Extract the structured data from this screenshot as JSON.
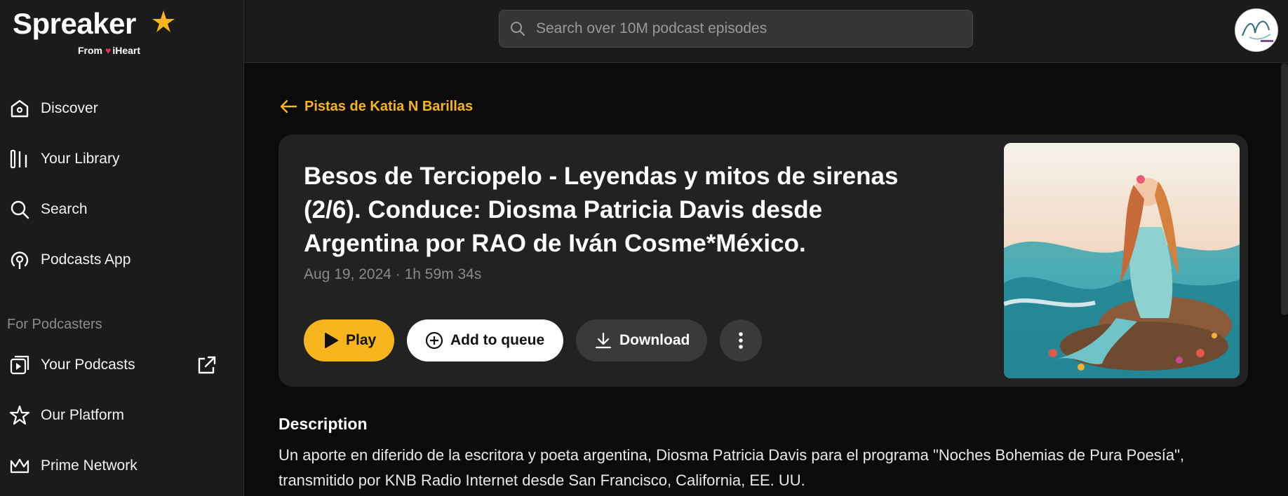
{
  "brand": {
    "name": "Spreaker",
    "from_label": "From",
    "partner": "iHeart"
  },
  "sidebar": {
    "items": [
      {
        "label": "Discover",
        "icon": "home-icon"
      },
      {
        "label": "Your Library",
        "icon": "library-icon"
      },
      {
        "label": "Search",
        "icon": "search-icon"
      },
      {
        "label": "Podcasts App",
        "icon": "podcast-icon"
      }
    ],
    "section_label": "For Podcasters",
    "podcaster_items": [
      {
        "label": "Your Podcasts",
        "icon": "play-square-icon"
      },
      {
        "label": "Our Platform",
        "icon": "star-icon"
      },
      {
        "label": "Prime Network",
        "icon": "crown-icon"
      }
    ]
  },
  "search": {
    "placeholder": "Search over 10M podcast episodes"
  },
  "episode": {
    "back_label": "Pistas de Katia N Barillas",
    "title": "Besos de Terciopelo - Leyendas y mitos de sirenas (2/6). Conduce: Diosma Patricia Davis desde Argentina por RAO de Iván Cosme*México.",
    "meta": "Aug 19, 2024 · 1h 59m 34s",
    "actions": {
      "play": "Play",
      "queue": "Add to queue",
      "download": "Download"
    }
  },
  "description": {
    "heading": "Description",
    "body": "Un aporte en diferido de la escritora y poeta argentina, Diosma Patricia Davis para el programa \"Noches Bohemias de Pura Poesía\", transmitido por KNB Radio Internet desde San Francisco, California, EE. UU."
  },
  "colors": {
    "accent": "#f6b51c",
    "sidebar_bg": "#1b1b1b",
    "card_bg": "#222222"
  }
}
